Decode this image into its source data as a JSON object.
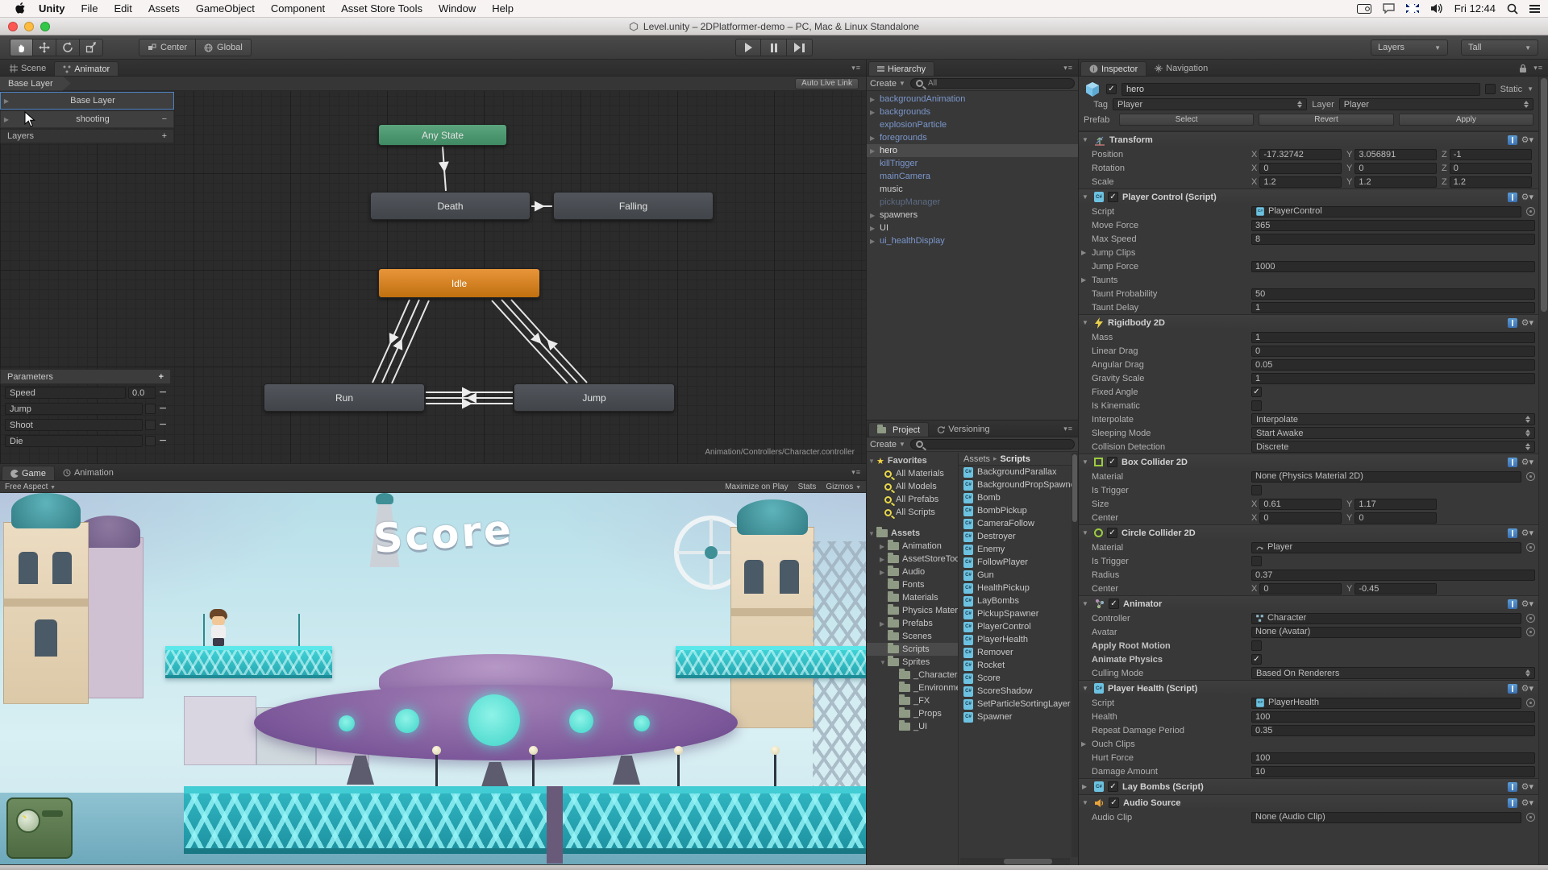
{
  "menubar": {
    "items": [
      "Unity",
      "File",
      "Edit",
      "Assets",
      "GameObject",
      "Component",
      "Asset Store Tools",
      "Window",
      "Help"
    ],
    "status_icons": [
      "display-camera-icon",
      "chat-bubble-icon",
      "uk-keyboard-flag-icon",
      "volume-icon",
      "spotlight-search-icon",
      "notification-list-icon"
    ],
    "clock": "Fri 12:44"
  },
  "titlebar": {
    "title": "Level.unity – 2DPlatformer-demo – PC, Mac & Linux Standalone"
  },
  "toolbar": {
    "tools": [
      "hand-tool",
      "move-tool",
      "rotate-tool",
      "scale-tool"
    ],
    "center": "Center",
    "global": "Global",
    "playback": [
      "play",
      "pause",
      "step"
    ],
    "layers": "Layers",
    "layout": "Tall"
  },
  "animator": {
    "tabs": [
      "Scene",
      "Animator"
    ],
    "breadcrumb": "Base Layer",
    "auto_live_link": "Auto Live Link",
    "layers": [
      {
        "label": "Base Layer",
        "selected": true
      },
      {
        "label": "shooting",
        "selected": false
      }
    ],
    "layers_footer": "Layers",
    "parameters": {
      "header": "Parameters",
      "rows": [
        {
          "name": "Speed",
          "kind": "float",
          "value": "0.0"
        },
        {
          "name": "Jump",
          "kind": "bool"
        },
        {
          "name": "Shoot",
          "kind": "bool"
        },
        {
          "name": "Die",
          "kind": "bool"
        }
      ]
    },
    "states": [
      {
        "label": "Any State",
        "kind": "entry"
      },
      {
        "label": "Death",
        "kind": "normal"
      },
      {
        "label": "Falling",
        "kind": "normal"
      },
      {
        "label": "Idle",
        "kind": "default"
      },
      {
        "label": "Run",
        "kind": "normal"
      },
      {
        "label": "Jump",
        "kind": "normal"
      }
    ],
    "asset_path": "Animation/Controllers/Character.controller"
  },
  "game": {
    "tabs": [
      "Game",
      "Animation"
    ],
    "aspect": "Free Aspect",
    "actions": [
      "Maximize on Play",
      "Stats",
      "Gizmos"
    ],
    "score": "Score"
  },
  "hierarchy": {
    "title": "Hierarchy",
    "create": "Create",
    "search": "All",
    "items": [
      {
        "label": "backgroundAnimation",
        "tone": "prefab",
        "arrow": true
      },
      {
        "label": "backgrounds",
        "tone": "prefab",
        "arrow": true
      },
      {
        "label": "explosionParticle",
        "tone": "prefab",
        "arrow": false
      },
      {
        "label": "foregrounds",
        "tone": "prefab",
        "arrow": true
      },
      {
        "label": "hero",
        "tone": "selected",
        "arrow": true,
        "selected": true
      },
      {
        "label": "killTrigger",
        "tone": "prefab",
        "arrow": false
      },
      {
        "label": "mainCamera",
        "tone": "prefab",
        "arrow": false
      },
      {
        "label": "music",
        "tone": "normal",
        "arrow": false
      },
      {
        "label": "pickupManager",
        "tone": "disabled",
        "arrow": false
      },
      {
        "label": "spawners",
        "tone": "normal",
        "arrow": true
      },
      {
        "label": "UI",
        "tone": "normal",
        "arrow": true
      },
      {
        "label": "ui_healthDisplay",
        "tone": "prefab",
        "arrow": true
      }
    ]
  },
  "project": {
    "tabs": [
      "Project",
      "Versioning"
    ],
    "create": "Create",
    "favorites": {
      "label": "Favorites",
      "items": [
        "All Materials",
        "All Models",
        "All Prefabs",
        "All Scripts"
      ]
    },
    "tree": [
      {
        "label": "Assets",
        "indent": 0,
        "arrow": "down"
      },
      {
        "label": "Animation",
        "indent": 1,
        "arrow": "right"
      },
      {
        "label": "AssetStoreTools",
        "indent": 1,
        "arrow": "right"
      },
      {
        "label": "Audio",
        "indent": 1,
        "arrow": "right"
      },
      {
        "label": "Fonts",
        "indent": 1
      },
      {
        "label": "Materials",
        "indent": 1
      },
      {
        "label": "Physics Materials",
        "indent": 1
      },
      {
        "label": "Prefabs",
        "indent": 1,
        "arrow": "right"
      },
      {
        "label": "Scenes",
        "indent": 1
      },
      {
        "label": "Scripts",
        "indent": 1,
        "selected": true
      },
      {
        "label": "Sprites",
        "indent": 1,
        "arrow": "down"
      },
      {
        "label": "_Characters",
        "indent": 2
      },
      {
        "label": "_Environment",
        "indent": 2
      },
      {
        "label": "_FX",
        "indent": 2
      },
      {
        "label": "_Props",
        "indent": 2
      },
      {
        "label": "_UI",
        "indent": 2
      }
    ],
    "breadcrumb": {
      "root": "Assets",
      "sep": "▸",
      "current": "Scripts"
    },
    "scripts": [
      "BackgroundParallax",
      "BackgroundPropSpawner",
      "Bomb",
      "BombPickup",
      "CameraFollow",
      "Destroyer",
      "Enemy",
      "FollowPlayer",
      "Gun",
      "HealthPickup",
      "LayBombs",
      "PickupSpawner",
      "PlayerControl",
      "PlayerHealth",
      "Remover",
      "Rocket",
      "Score",
      "ScoreShadow",
      "SetParticleSortingLayer",
      "Spawner"
    ]
  },
  "inspector": {
    "tabs": [
      "Inspector",
      "Navigation"
    ],
    "object": {
      "name": "hero",
      "static_label": "Static",
      "tag_label": "Tag",
      "tag": "Player",
      "layer_label": "Layer",
      "layer": "Player",
      "prefab_label": "Prefab",
      "prefab_buttons": [
        "Select",
        "Revert",
        "Apply"
      ]
    },
    "components": [
      {
        "title": "Transform",
        "icon": "transform",
        "rows": [
          {
            "label": "Position",
            "type": "vec3",
            "x": "-17.32742",
            "y": "3.056891",
            "z": "-1"
          },
          {
            "label": "Rotation",
            "type": "vec3",
            "x": "0",
            "y": "0",
            "z": "0"
          },
          {
            "label": "Scale",
            "type": "vec3",
            "x": "1.2",
            "y": "1.2",
            "z": "1.2"
          }
        ]
      },
      {
        "title": "Player Control (Script)",
        "icon": "script",
        "enabled": true,
        "rows": [
          {
            "label": "Script",
            "type": "object",
            "value": "PlayerControl",
            "obj_icon": "script"
          },
          {
            "label": "Move Force",
            "type": "text",
            "value": "365"
          },
          {
            "label": "Max Speed",
            "type": "text",
            "value": "8"
          },
          {
            "label": "Jump Clips",
            "type": "foldout"
          },
          {
            "label": "Jump Force",
            "type": "text",
            "value": "1000"
          },
          {
            "label": "Taunts",
            "type": "foldout"
          },
          {
            "label": "Taunt Probability",
            "type": "text",
            "value": "50"
          },
          {
            "label": "Taunt Delay",
            "type": "text",
            "value": "1"
          }
        ]
      },
      {
        "title": "Rigidbody 2D",
        "icon": "rigidbody",
        "rows": [
          {
            "label": "Mass",
            "type": "text",
            "value": "1"
          },
          {
            "label": "Linear Drag",
            "type": "text",
            "value": "0"
          },
          {
            "label": "Angular Drag",
            "type": "text",
            "value": "0.05"
          },
          {
            "label": "Gravity Scale",
            "type": "text",
            "value": "1"
          },
          {
            "label": "Fixed Angle",
            "type": "check",
            "checked": true
          },
          {
            "label": "Is Kinematic",
            "type": "check",
            "checked": false
          },
          {
            "label": "Interpolate",
            "type": "dropdown",
            "value": "Interpolate"
          },
          {
            "label": "Sleeping Mode",
            "type": "dropdown",
            "value": "Start Awake"
          },
          {
            "label": "Collision Detection",
            "type": "dropdown",
            "value": "Discrete"
          }
        ]
      },
      {
        "title": "Box Collider 2D",
        "icon": "box-collider",
        "enabled": true,
        "rows": [
          {
            "label": "Material",
            "type": "object",
            "value": "None (Physics Material 2D)"
          },
          {
            "label": "Is Trigger",
            "type": "check",
            "checked": false
          },
          {
            "label": "Size",
            "type": "vec2",
            "x": "0.61",
            "y": "1.17"
          },
          {
            "label": "Center",
            "type": "vec2",
            "x": "0",
            "y": "0"
          }
        ]
      },
      {
        "title": "Circle Collider 2D",
        "icon": "circle-collider",
        "enabled": true,
        "rows": [
          {
            "label": "Material",
            "type": "object",
            "value": "Player",
            "obj_icon": "physmat"
          },
          {
            "label": "Is Trigger",
            "type": "check",
            "checked": false
          },
          {
            "label": "Radius",
            "type": "text",
            "value": "0.37"
          },
          {
            "label": "Center",
            "type": "vec2",
            "x": "0",
            "y": "-0.45"
          }
        ]
      },
      {
        "title": "Animator",
        "icon": "animator",
        "enabled": true,
        "rows": [
          {
            "label": "Controller",
            "type": "object",
            "value": "Character",
            "obj_icon": "controller"
          },
          {
            "label": "Avatar",
            "type": "object",
            "value": "None (Avatar)"
          },
          {
            "label": "Apply Root Motion",
            "type": "check",
            "checked": false,
            "bold": true
          },
          {
            "label": "Animate Physics",
            "type": "check",
            "checked": true,
            "bold": true
          },
          {
            "label": "Culling Mode",
            "type": "dropdown",
            "value": "Based On Renderers"
          }
        ]
      },
      {
        "title": "Player Health (Script)",
        "icon": "script",
        "rows": [
          {
            "label": "Script",
            "type": "object",
            "value": "PlayerHealth",
            "obj_icon": "script"
          },
          {
            "label": "Health",
            "type": "text",
            "value": "100"
          },
          {
            "label": "Repeat Damage Period",
            "type": "text",
            "value": "0.35"
          },
          {
            "label": "Ouch Clips",
            "type": "foldout"
          },
          {
            "label": "Hurt Force",
            "type": "text",
            "value": "100"
          },
          {
            "label": "Damage Amount",
            "type": "text",
            "value": "10"
          }
        ]
      },
      {
        "title": "Lay Bombs (Script)",
        "icon": "script",
        "enabled": true,
        "collapsed": true,
        "rows": []
      },
      {
        "title": "Audio Source",
        "icon": "audio",
        "enabled": true,
        "rows": [
          {
            "label": "Audio Clip",
            "type": "object",
            "value": "None (Audio Clip)"
          }
        ]
      }
    ]
  },
  "colors": {
    "state_entry": "#4a9e78",
    "state_default": "#d8821e",
    "state_normal": "#4a4e54",
    "hierarchy_prefab_text": "#7b97cc",
    "selection_row": "#4a4a4a",
    "platform_cyan": "#3ed3d6",
    "ufo_purple": "#8a64a0",
    "panel_background": "#383838"
  }
}
